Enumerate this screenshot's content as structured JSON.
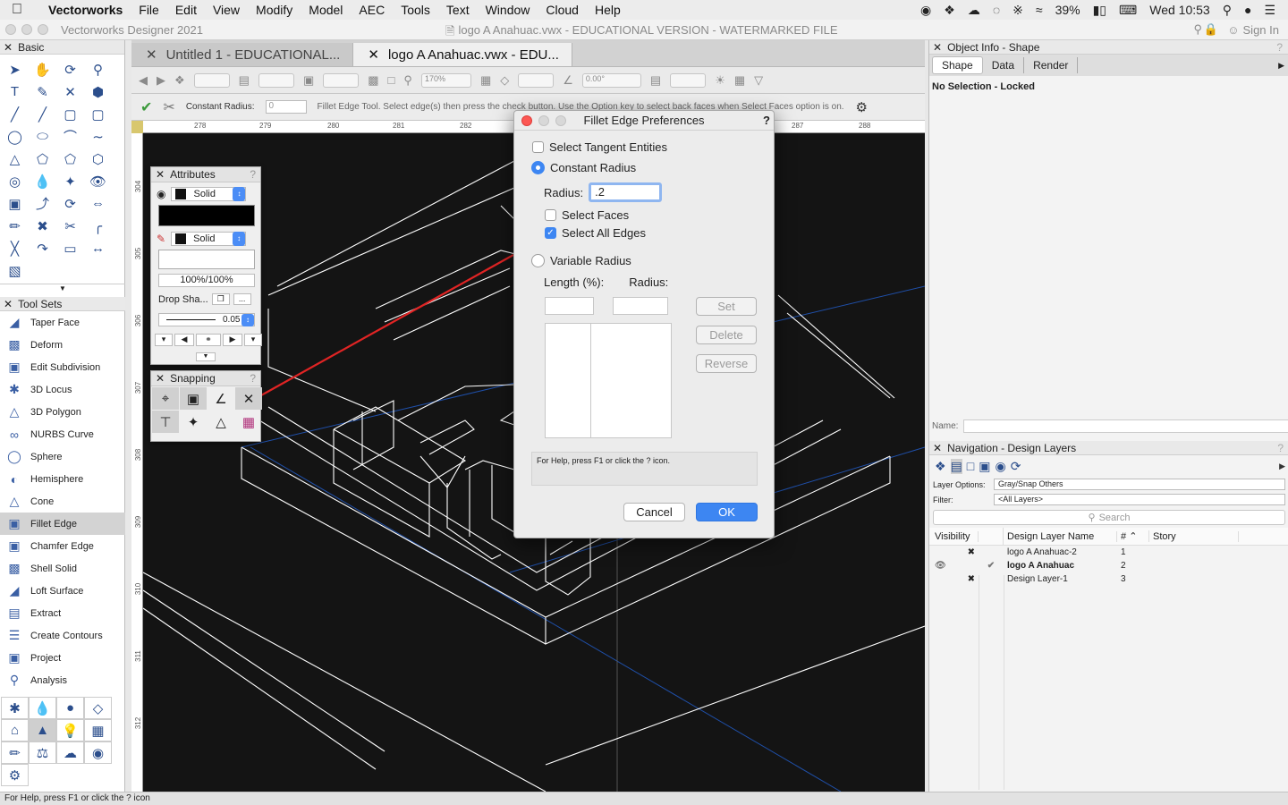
{
  "menubar": {
    "app": "Vectorworks",
    "items": [
      "File",
      "Edit",
      "View",
      "Modify",
      "Model",
      "AEC",
      "Tools",
      "Text",
      "Window",
      "Cloud",
      "Help"
    ],
    "battery": "39%",
    "clock": "Wed 10:53"
  },
  "window": {
    "app_title": "Vectorworks Designer 2021",
    "doc_title": "logo A Anahuac.vwx - EDUCATIONAL VERSION - WATERMARKED FILE",
    "sign_in": "Sign In"
  },
  "tabs": [
    {
      "label": "Untitled 1 - EDUCATIONAL..."
    },
    {
      "label": "logo A Anahuac.vwx - EDU..."
    }
  ],
  "toolbar": {
    "zoom": "170%",
    "angle": "0.00°"
  },
  "modebar": {
    "radius_label": "Constant Radius:",
    "radius_value": "0",
    "hint": "Fillet Edge Tool. Select edge(s) then press the check button. Use the Option key to select back faces when Select Faces option is on."
  },
  "rulers": {
    "top": [
      "278",
      "279",
      "280",
      "281",
      "282",
      "287",
      "288"
    ],
    "left": [
      "304",
      "305",
      "306",
      "307",
      "308",
      "309",
      "310",
      "311",
      "312"
    ]
  },
  "basic_palette": {
    "title": "Basic"
  },
  "tool_sets": {
    "title": "Tool Sets",
    "items": [
      {
        "label": "Taper Face",
        "icon": "taper-face-icon"
      },
      {
        "label": "Deform",
        "icon": "deform-icon"
      },
      {
        "label": "Edit Subdivision",
        "icon": "edit-subdivision-icon"
      },
      {
        "label": "3D Locus",
        "icon": "3d-locus-icon"
      },
      {
        "label": "3D Polygon",
        "icon": "3d-polygon-icon"
      },
      {
        "label": "NURBS Curve",
        "icon": "nurbs-curve-icon"
      },
      {
        "label": "Sphere",
        "icon": "sphere-icon"
      },
      {
        "label": "Hemisphere",
        "icon": "hemisphere-icon"
      },
      {
        "label": "Cone",
        "icon": "cone-icon"
      },
      {
        "label": "Fillet Edge",
        "icon": "fillet-edge-icon",
        "selected": true
      },
      {
        "label": "Chamfer Edge",
        "icon": "chamfer-edge-icon"
      },
      {
        "label": "Shell Solid",
        "icon": "shell-solid-icon"
      },
      {
        "label": "Loft Surface",
        "icon": "loft-surface-icon"
      },
      {
        "label": "Extract",
        "icon": "extract-icon"
      },
      {
        "label": "Create Contours",
        "icon": "create-contours-icon"
      },
      {
        "label": "Project",
        "icon": "project-icon"
      },
      {
        "label": "Analysis",
        "icon": "analysis-icon"
      }
    ]
  },
  "attributes": {
    "title": "Attributes",
    "fill_style": "Solid",
    "pen_style": "Solid",
    "opacity": "100%/100%",
    "drop_shadow": "Drop Sha...",
    "line_weight": "0.05"
  },
  "snapping": {
    "title": "Snapping"
  },
  "dialog": {
    "title": "Fillet Edge Preferences",
    "select_tangent": "Select Tangent Entities",
    "constant_radius": "Constant Radius",
    "radius_label": "Radius:",
    "radius_value": ".2",
    "select_faces": "Select Faces",
    "select_all_edges": "Select All Edges",
    "variable_radius": "Variable Radius",
    "length_label": "Length (%):",
    "var_radius_label": "Radius:",
    "set_btn": "Set",
    "delete_btn": "Delete",
    "reverse_btn": "Reverse",
    "help_text": "For Help, press F1 or click the ? icon.",
    "cancel": "Cancel",
    "ok": "OK",
    "accent": "#3d86f2"
  },
  "object_info": {
    "title": "Object Info - Shape",
    "tabs": [
      "Shape",
      "Data",
      "Render"
    ],
    "status": "No Selection - Locked",
    "name_label": "Name:"
  },
  "navigation": {
    "title": "Navigation - Design Layers",
    "layer_options_label": "Layer Options:",
    "layer_options_value": "Gray/Snap Others",
    "filter_label": "Filter:",
    "filter_value": "<All Layers>",
    "search_placeholder": "Search",
    "columns": [
      "Visibility",
      "Design Layer Name",
      "#",
      "Story"
    ],
    "rows": [
      {
        "name": "logo A Anahuac-2",
        "num": "1"
      },
      {
        "name": "logo A Anahuac",
        "num": "2"
      },
      {
        "name": "Design Layer-1",
        "num": "3"
      }
    ]
  },
  "statusbar": {
    "text": "For Help, press F1 or click the ? icon"
  },
  "colors": {
    "highlight_edge": "#e02424",
    "wire": "#ffffff",
    "guide": "#1f4fa8"
  }
}
